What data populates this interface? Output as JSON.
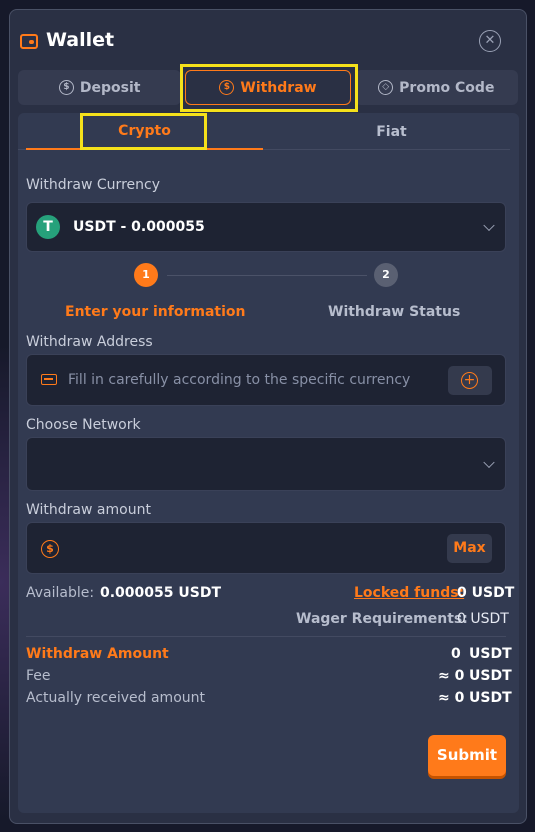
{
  "header": {
    "title": "Wallet"
  },
  "tabs": [
    {
      "label": "Deposit",
      "icon": "deposit-icon"
    },
    {
      "label": "Withdraw",
      "icon": "withdraw-icon"
    },
    {
      "label": "Promo Code",
      "icon": "promo-icon"
    }
  ],
  "subtabs": [
    {
      "label": "Crypto"
    },
    {
      "label": "Fiat"
    }
  ],
  "withdraw_currency": {
    "label": "Withdraw Currency",
    "selected": "USDT - 0.000055",
    "logo_glyph": "T"
  },
  "steps": [
    {
      "number": "1",
      "label": "Enter your information"
    },
    {
      "number": "2",
      "label": "Withdraw Status"
    }
  ],
  "address": {
    "label": "Withdraw Address",
    "placeholder": "Fill in carefully according to the specific currency"
  },
  "network": {
    "label": "Choose Network",
    "selected": ""
  },
  "amount": {
    "label": "Withdraw amount",
    "value": "",
    "max_label": "Max"
  },
  "available": {
    "label": "Available:",
    "value": "0.000055 USDT"
  },
  "locked": {
    "label": "Locked funds:",
    "value": "0 USDT"
  },
  "wager": {
    "label": "Wager Requirements:",
    "value": "0 USDT"
  },
  "summary": {
    "withdraw_amount_label": "Withdraw Amount",
    "withdraw_amount_value": "0",
    "withdraw_amount_unit": "USDT",
    "fee_label": "Fee",
    "fee_value": "≈ 0",
    "fee_unit": "USDT",
    "received_label": "Actually received amount",
    "received_value": "≈ 0",
    "received_unit": "USDT"
  },
  "submit_label": "Submit",
  "colors": {
    "accent": "#ff7a1a",
    "highlight": "#f5e11b",
    "panel": "#323a51"
  }
}
